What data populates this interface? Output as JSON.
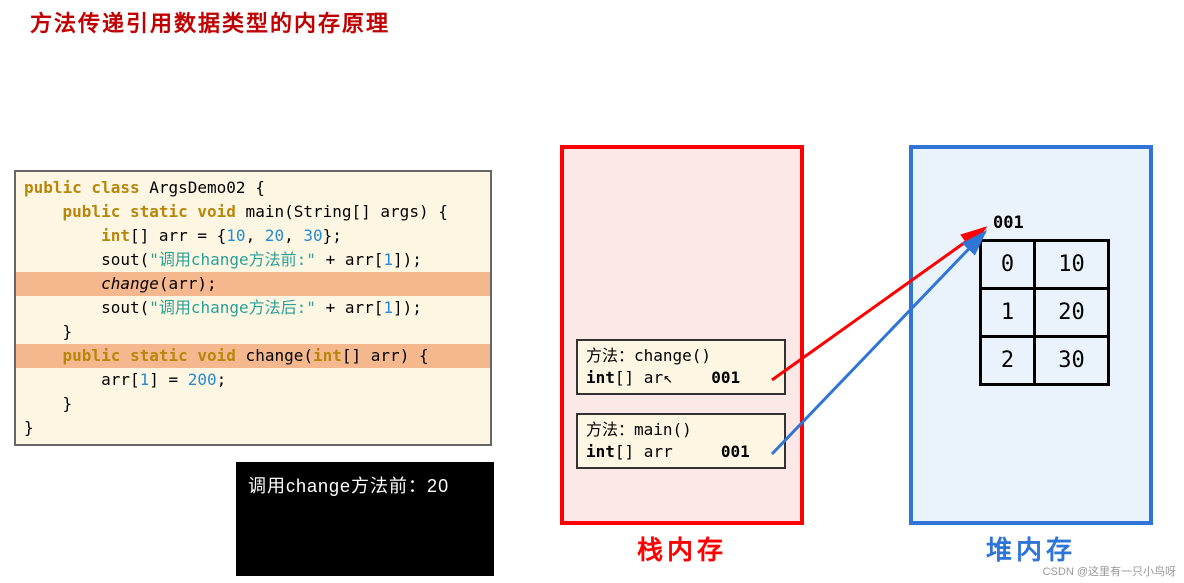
{
  "title": "方法传递引用数据类型的内存原理",
  "code": {
    "l1a": "public class",
    "l1b": " ArgsDemo02 {",
    "l2a": "public static void",
    "l2b": " main(String[] args) {",
    "l3a": "int",
    "l3b": "[] arr = {",
    "l3c": "10",
    "l3d": ", ",
    "l3e": "20",
    "l3f": ", ",
    "l3g": "30",
    "l3h": "};",
    "l4a": "        sout(",
    "l4b": "\"调用change方法前:\"",
    "l4c": " + arr[",
    "l4d": "1",
    "l4e": "]);",
    "l5a": "change",
    "l5b": "(arr);",
    "l6a": "        sout(",
    "l6b": "\"调用change方法后:\"",
    "l6c": " + arr[",
    "l6d": "1",
    "l6e": "]);",
    "l7": "    }",
    "l8a": "public static void",
    "l8b": " change(",
    "l8c": "int",
    "l8d": "[] arr) {",
    "l9a": "        arr[",
    "l9b": "1",
    "l9c": "] = ",
    "l9d": "200",
    "l9e": ";",
    "l10": "    }",
    "l11": "}"
  },
  "console_output": "调用change方法前：20",
  "stack": {
    "label": "栈内存",
    "frame_change": {
      "line1": "方法：change()",
      "line2a": "int",
      "line2b": "[] ar",
      "cursor": "↖",
      "addr": "001"
    },
    "frame_main": {
      "line1": "方法：main()",
      "line2a": "int",
      "line2b": "[] arr",
      "addr": "001"
    }
  },
  "heap": {
    "label": "堆内存",
    "address": "001",
    "array": [
      {
        "idx": "0",
        "val": "10"
      },
      {
        "idx": "1",
        "val": "20"
      },
      {
        "idx": "2",
        "val": "30"
      }
    ]
  },
  "watermark": "CSDN @这里有一只小鸟呀"
}
